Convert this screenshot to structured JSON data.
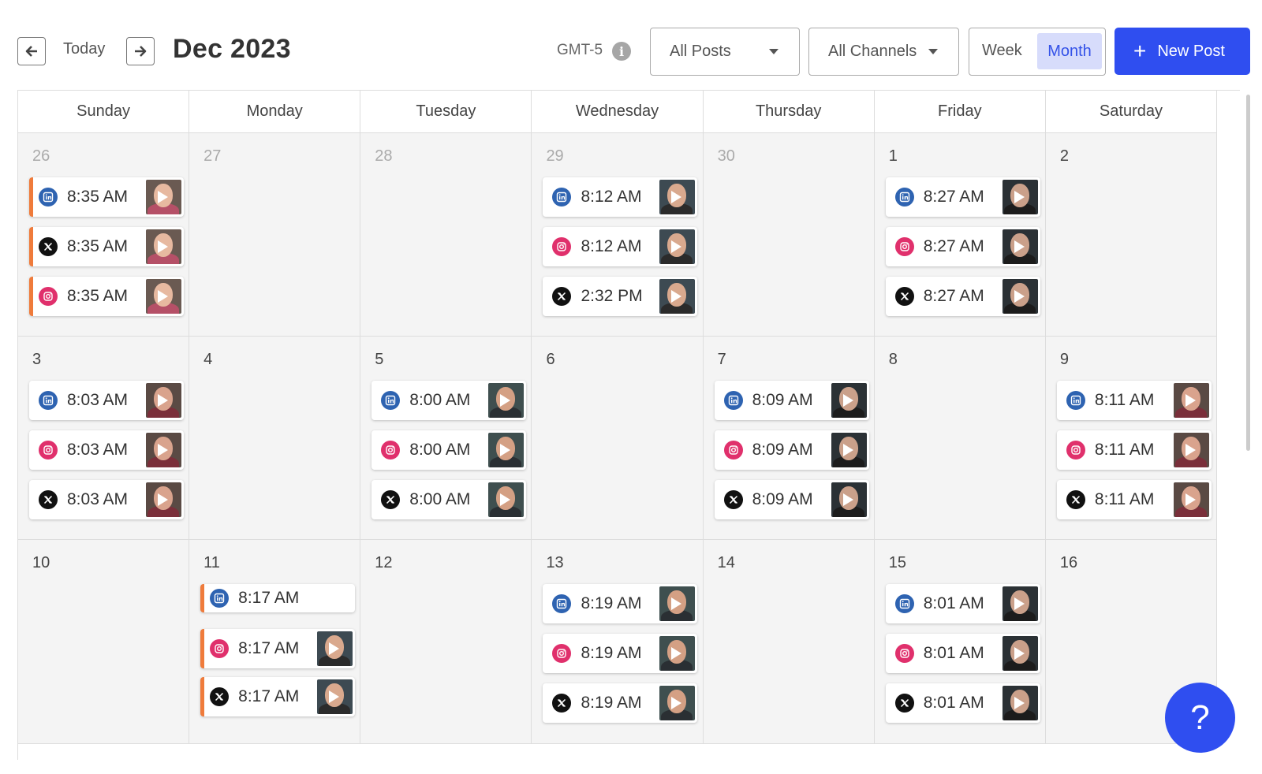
{
  "toolbar": {
    "today_label": "Today",
    "month_title": "Dec 2023",
    "timezone": "GMT-5",
    "info_glyph": "i",
    "posts_filter": "All Posts",
    "channels_filter": "All Channels",
    "week_label": "Week",
    "month_label": "Month",
    "new_post_label": "New Post",
    "new_post_glyph": "+"
  },
  "colors": {
    "accent": "#2f4ef0",
    "draft_marker": "#ef7b3b",
    "linkedin": "#2e63b1",
    "instagram": "#e0306c",
    "x": "#111111"
  },
  "weekdays": [
    "Sunday",
    "Monday",
    "Tuesday",
    "Wednesday",
    "Thursday",
    "Friday",
    "Saturday"
  ],
  "weeks": [
    [
      {
        "date": "26",
        "dim": true,
        "posts": [
          {
            "channel": "linkedin",
            "time": "8:35 AM",
            "draft": true,
            "thumb": "woman"
          },
          {
            "channel": "x",
            "time": "8:35 AM",
            "draft": true,
            "thumb": "woman"
          },
          {
            "channel": "instagram",
            "time": "8:35 AM",
            "draft": true,
            "thumb": "woman"
          }
        ]
      },
      {
        "date": "27",
        "dim": true,
        "posts": []
      },
      {
        "date": "28",
        "dim": true,
        "posts": []
      },
      {
        "date": "29",
        "dim": true,
        "posts": [
          {
            "channel": "linkedin",
            "time": "8:12 AM",
            "thumb": "glasses-man"
          },
          {
            "channel": "instagram",
            "time": "8:12 AM",
            "thumb": "glasses-man"
          },
          {
            "channel": "x",
            "time": "2:32 PM",
            "thumb": "glasses-man"
          }
        ]
      },
      {
        "date": "30",
        "dim": true,
        "posts": []
      },
      {
        "date": "1",
        "dim": false,
        "posts": [
          {
            "channel": "linkedin",
            "time": "8:27 AM",
            "thumb": "glasses-man-dark"
          },
          {
            "channel": "instagram",
            "time": "8:27 AM",
            "thumb": "glasses-man-dark"
          },
          {
            "channel": "x",
            "time": "8:27 AM",
            "thumb": "glasses-man-dark"
          }
        ]
      },
      {
        "date": "2",
        "dim": false,
        "posts": []
      }
    ],
    [
      {
        "date": "3",
        "dim": false,
        "posts": [
          {
            "channel": "linkedin",
            "time": "8:03 AM",
            "thumb": "woman-mic"
          },
          {
            "channel": "instagram",
            "time": "8:03 AM",
            "thumb": "woman-mic"
          },
          {
            "channel": "x",
            "time": "8:03 AM",
            "thumb": "woman-mic"
          }
        ]
      },
      {
        "date": "4",
        "dim": false,
        "posts": []
      },
      {
        "date": "5",
        "dim": false,
        "posts": [
          {
            "channel": "linkedin",
            "time": "8:00 AM",
            "thumb": "man"
          },
          {
            "channel": "instagram",
            "time": "8:00 AM",
            "thumb": "man"
          },
          {
            "channel": "x",
            "time": "8:00 AM",
            "thumb": "man"
          }
        ]
      },
      {
        "date": "6",
        "dim": false,
        "posts": []
      },
      {
        "date": "7",
        "dim": false,
        "posts": [
          {
            "channel": "linkedin",
            "time": "8:09 AM",
            "thumb": "glasses-man-dark"
          },
          {
            "channel": "instagram",
            "time": "8:09 AM",
            "thumb": "glasses-man-dark"
          },
          {
            "channel": "x",
            "time": "8:09 AM",
            "thumb": "glasses-man-dark"
          }
        ]
      },
      {
        "date": "8",
        "dim": false,
        "posts": []
      },
      {
        "date": "9",
        "dim": false,
        "posts": [
          {
            "channel": "linkedin",
            "time": "8:11 AM",
            "thumb": "woman-mic"
          },
          {
            "channel": "instagram",
            "time": "8:11 AM",
            "thumb": "woman-mic"
          },
          {
            "channel": "x",
            "time": "8:11 AM",
            "thumb": "woman-mic"
          }
        ]
      }
    ],
    [
      {
        "date": "10",
        "dim": false,
        "posts": []
      },
      {
        "date": "11",
        "dim": false,
        "posts": [
          {
            "channel": "linkedin",
            "time": "8:17 AM",
            "draft": true,
            "thumb": "none"
          },
          {
            "channel": "instagram",
            "time": "8:17 AM",
            "draft": true,
            "thumb": "glasses-man"
          },
          {
            "channel": "x",
            "time": "8:17 AM",
            "draft": true,
            "thumb": "glasses-man"
          }
        ]
      },
      {
        "date": "12",
        "dim": false,
        "posts": []
      },
      {
        "date": "13",
        "dim": false,
        "posts": [
          {
            "channel": "linkedin",
            "time": "8:19 AM",
            "thumb": "man"
          },
          {
            "channel": "instagram",
            "time": "8:19 AM",
            "thumb": "man"
          },
          {
            "channel": "x",
            "time": "8:19 AM",
            "thumb": "man"
          }
        ]
      },
      {
        "date": "14",
        "dim": false,
        "posts": []
      },
      {
        "date": "15",
        "dim": false,
        "posts": [
          {
            "channel": "linkedin",
            "time": "8:01 AM",
            "thumb": "glasses-man-dark"
          },
          {
            "channel": "instagram",
            "time": "8:01 AM",
            "thumb": "glasses-man-dark"
          },
          {
            "channel": "x",
            "time": "8:01 AM",
            "thumb": "glasses-man-dark"
          }
        ]
      },
      {
        "date": "16",
        "dim": false,
        "posts": []
      }
    ]
  ],
  "help_glyph": "?"
}
